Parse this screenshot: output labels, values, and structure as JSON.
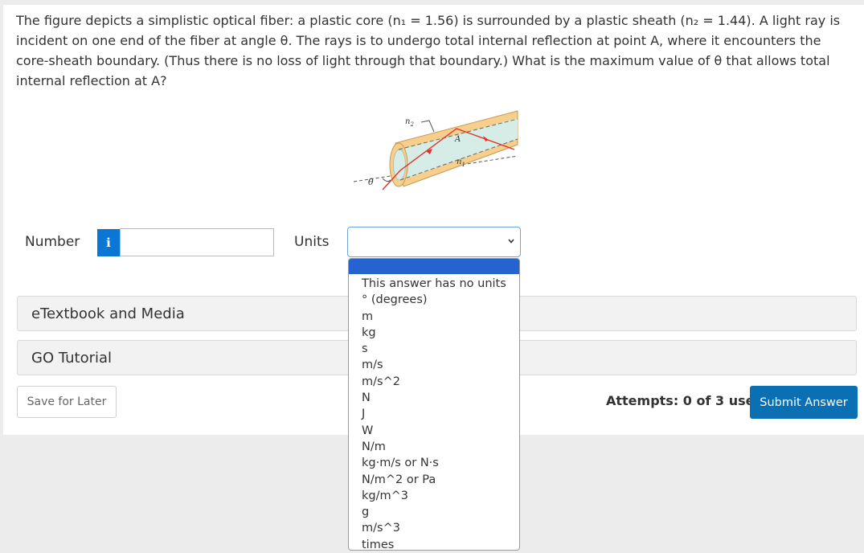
{
  "question": {
    "text": "The figure depicts a simplistic optical fiber: a plastic core (n₁ = 1.56) is surrounded by a plastic sheath (n₂ = 1.44). A light ray is incident on one end of the fiber at angle θ. The rays is to undergo total internal reflection at point A, where it encounters the core-sheath boundary. (Thus there is no loss of light through that boundary.) What is the maximum value of θ that allows total internal reflection at A?"
  },
  "figure": {
    "label_n2": "n",
    "label_n2_sub": "2",
    "label_n1": "n",
    "label_n1_sub": "1",
    "label_A": "A",
    "label_theta": "θ",
    "colors": {
      "sheath": "#f6cf8d",
      "core": "#d6ece6",
      "ray": "#e0322a"
    }
  },
  "answer": {
    "number_label": "Number",
    "number_value": "",
    "info_icon": "i",
    "units_label": "Units",
    "units_selected": "",
    "units_options": [
      "This answer has no units",
      "° (degrees)",
      "m",
      "kg",
      "s",
      "m/s",
      "m/s^2",
      "N",
      "J",
      "W",
      "N/m",
      "kg·m/s or N·s",
      "N/m^2 or Pa",
      "kg/m^3",
      "g",
      "m/s^3",
      "times"
    ]
  },
  "resources": {
    "etextbook_label": "eTextbook and Media",
    "go_tutorial_label": "GO Tutorial"
  },
  "footer": {
    "save_label": "Save for Later",
    "attempts_text": "Attempts: 0 of 3 used",
    "submit_label": "Submit Answer"
  },
  "colors": {
    "accent": "#0a6fb3",
    "info": "#0a77d5",
    "dropdown_highlight": "#2563d1"
  }
}
